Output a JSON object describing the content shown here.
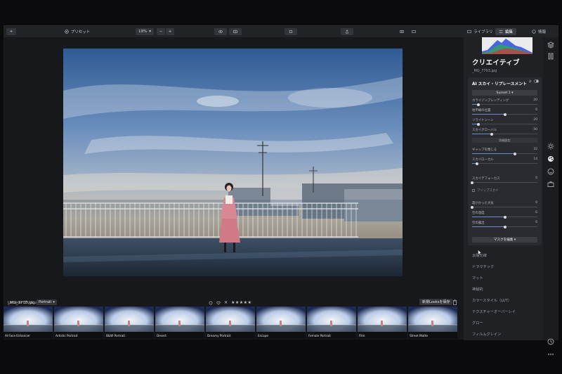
{
  "toolbar": {
    "add_label": "+",
    "presets_label": "プリセット",
    "zoom_value": "19%",
    "zoom_minus": "−",
    "zoom_plus": "+",
    "library_tab": "ライブラリ",
    "edit_tab": "編集",
    "info_tab": "情報"
  },
  "image": {
    "filename": "_MG_7703.jpg",
    "rating_stars": "★★★★★",
    "reject_mark": "✕"
  },
  "presets": {
    "label": "Luminar プリセット",
    "category": "Portrait",
    "save_looks": "新規Looksを保存",
    "items": [
      {
        "label": "AI Face Enhancer"
      },
      {
        "label": "Artistic Portrait"
      },
      {
        "label": "B&W Portrait"
      },
      {
        "label": "Desert"
      },
      {
        "label": "Dreamy Portrait"
      },
      {
        "label": "Escape"
      },
      {
        "label": "Female Portrait"
      },
      {
        "label": "Film"
      },
      {
        "label": "Street Matte"
      }
    ]
  },
  "panel": {
    "title": "クリエイティブ",
    "filename": "_MG_7703.jpg",
    "tool": {
      "title": "AI スカイ・リプレースメント",
      "sky_preset": "Sunset 1",
      "sliders1": [
        {
          "label": "ホライゾンブレンディング",
          "value": "20",
          "fraction": 0.1
        },
        {
          "label": "地平線の位置",
          "value": "0",
          "fraction": 0.5
        },
        {
          "label": "リライトシーン",
          "value": "20",
          "fraction": 0.1
        },
        {
          "label": "スカイグローバル",
          "value": "50",
          "fraction": 0.3
        }
      ],
      "advanced_label": "詳細設定",
      "sliders2": [
        {
          "label": "ギャップを閉じる",
          "value": "32",
          "fraction": 0.66
        },
        {
          "label": "スカイローカル",
          "value": "14",
          "fraction": 0.07
        }
      ],
      "sliders3": [
        {
          "label": "スカイデフォーカス",
          "value": "0",
          "fraction": 0.0
        }
      ],
      "flip_sky": "フリップスカイ",
      "sliders4": [
        {
          "label": "霞がかった大気",
          "value": "0",
          "fraction": 0.0
        },
        {
          "label": "空の温度",
          "value": "0",
          "fraction": 0.5
        },
        {
          "label": "空の露出",
          "value": "0",
          "fraction": 0.5
        }
      ],
      "mask_button": "マスクを編集"
    },
    "categories": [
      "太陽光線",
      "ドラマチック",
      "マット",
      "神秘的",
      "カラースタイル（LUT）",
      "テクスチャーオーバーレイ",
      "グロー",
      "フィルムグレイン"
    ]
  }
}
